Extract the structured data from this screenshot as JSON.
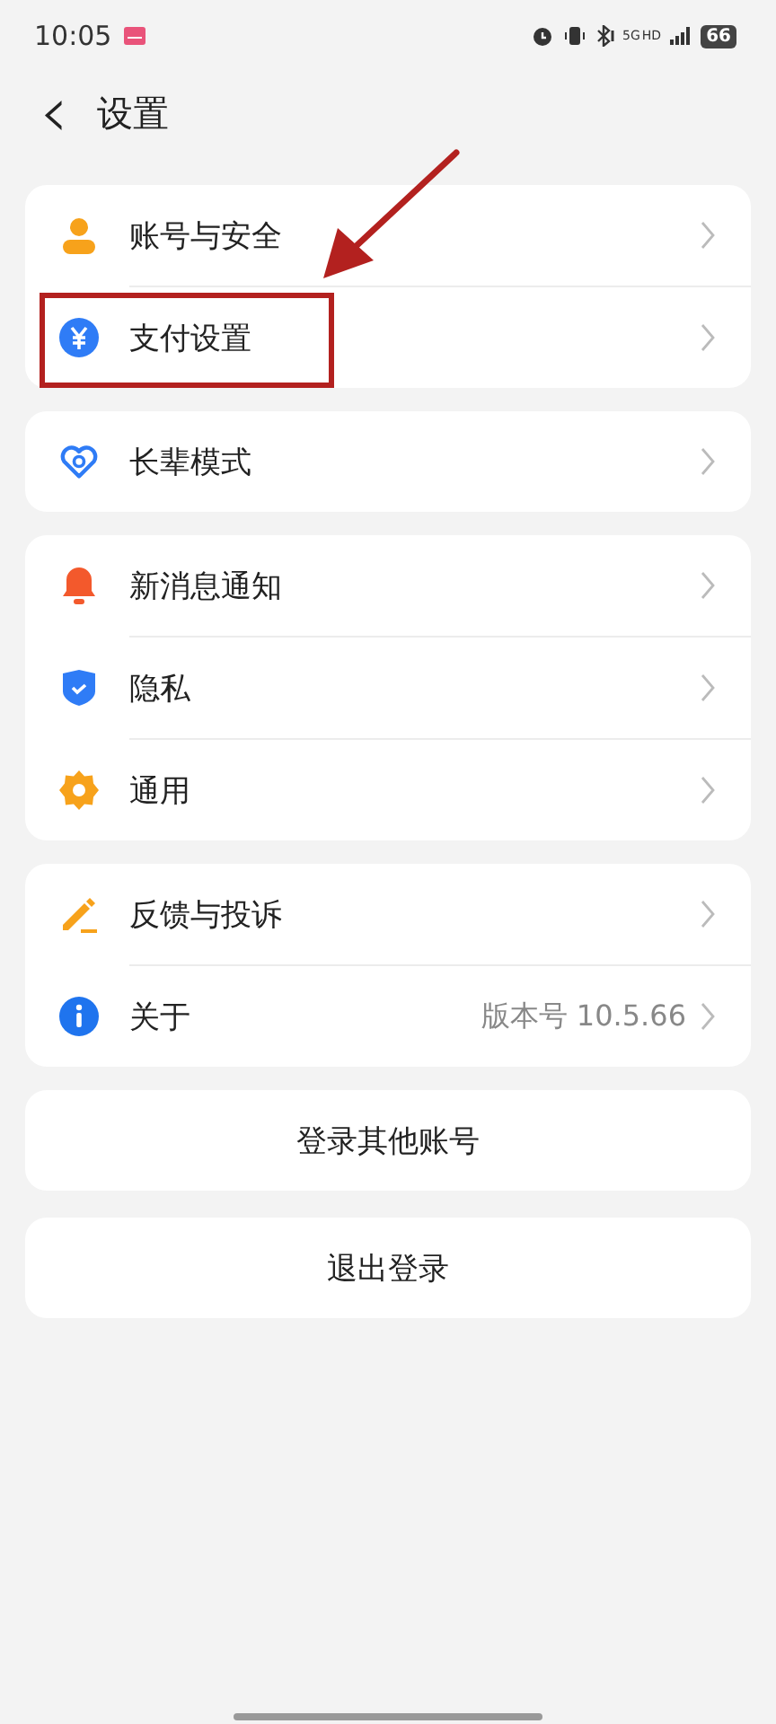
{
  "status_bar": {
    "time": "10:05",
    "network": "5G",
    "network_badge": "HD",
    "battery": "66"
  },
  "header": {
    "back": "‹",
    "title": "设置"
  },
  "groups": [
    {
      "items": [
        {
          "label": "账号与安全",
          "highlighted": false
        },
        {
          "label": "支付设置",
          "highlighted": true
        }
      ]
    },
    {
      "items": [
        {
          "label": "长辈模式",
          "highlighted": false
        }
      ]
    },
    {
      "items": [
        {
          "label": "新消息通知",
          "highlighted": false
        },
        {
          "label": "隐私",
          "highlighted": false
        },
        {
          "label": "通用",
          "highlighted": false
        }
      ]
    },
    {
      "items": [
        {
          "label": "反馈与投诉",
          "highlighted": false
        },
        {
          "label": "关于",
          "value": "版本号 10.5.66",
          "highlighted": false
        }
      ]
    }
  ],
  "buttons": [
    "登录其他账号",
    "退出登录"
  ]
}
